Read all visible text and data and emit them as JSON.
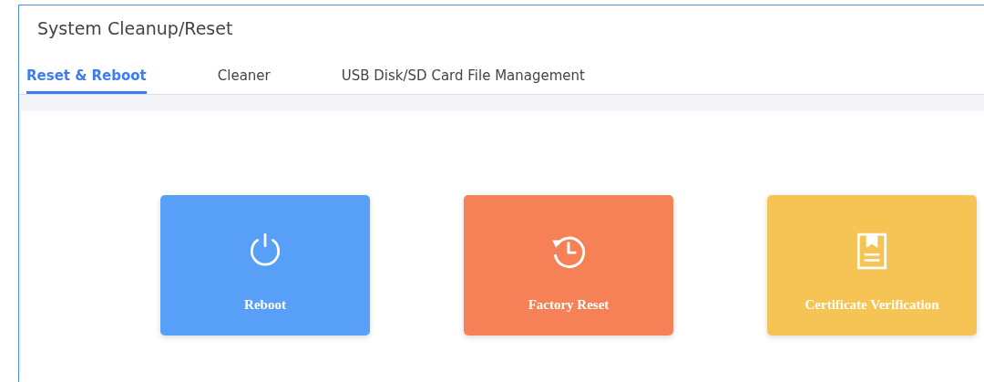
{
  "page": {
    "title": "System Cleanup/Reset"
  },
  "tabs": [
    {
      "label": "Reset & Reboot",
      "selected": true
    },
    {
      "label": "Cleaner",
      "selected": false
    },
    {
      "label": "USB Disk/SD Card File Management",
      "selected": false
    }
  ],
  "cards": [
    {
      "kind": "power",
      "label": "Reboot",
      "color": "#589ff7"
    },
    {
      "kind": "history",
      "label": "Factory Reset",
      "color": "#f78156"
    },
    {
      "kind": "certificate",
      "label": "Certificate Verification",
      "color": "#f5c454"
    }
  ]
}
